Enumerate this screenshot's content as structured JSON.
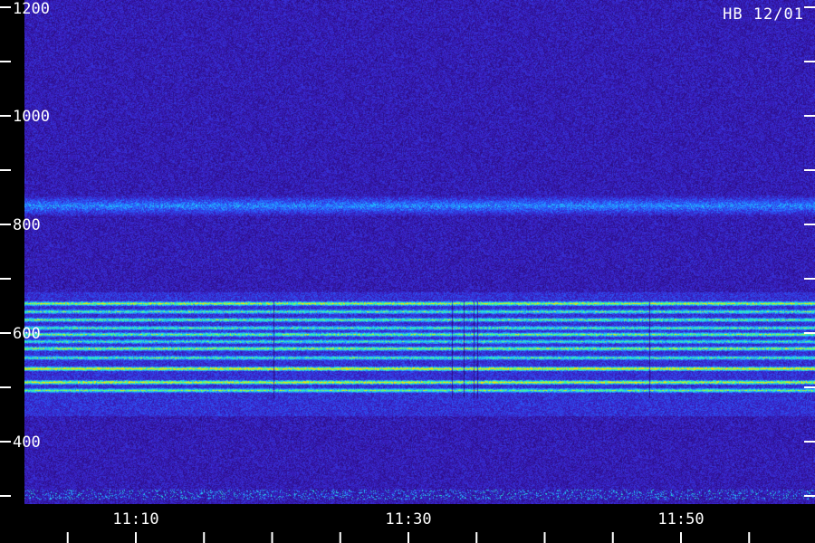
{
  "station_tag": "HB 12/01",
  "chart_data": {
    "type": "heatmap",
    "title": "",
    "xlabel": "",
    "ylabel": "",
    "x_ticks": [
      "11:10",
      "11:30",
      "11:50"
    ],
    "y_ticks": [
      400,
      600,
      800,
      1000,
      1200
    ],
    "x_range_minutes": [
      "11:02",
      "11:59"
    ],
    "ylim": [
      300,
      1200
    ],
    "y_minor_tick_step": 100,
    "x_minor_tick_step_minutes": 5,
    "colormap": [
      "#000000",
      "#2a0a7a",
      "#3a22c8",
      "#2860ff",
      "#20c8ff",
      "#40ff90",
      "#ffe000"
    ],
    "bands": [
      {
        "y": 655,
        "intensity": 0.75
      },
      {
        "y": 640,
        "intensity": 0.55
      },
      {
        "y": 625,
        "intensity": 0.6
      },
      {
        "y": 610,
        "intensity": 0.55
      },
      {
        "y": 598,
        "intensity": 0.65
      },
      {
        "y": 585,
        "intensity": 0.5
      },
      {
        "y": 572,
        "intensity": 0.7
      },
      {
        "y": 555,
        "intensity": 0.55
      },
      {
        "y": 535,
        "intensity": 0.9
      },
      {
        "y": 510,
        "intensity": 0.8
      },
      {
        "y": 495,
        "intensity": 0.6
      }
    ],
    "ripple_band": {
      "y": 835,
      "intensity": 0.3
    }
  }
}
